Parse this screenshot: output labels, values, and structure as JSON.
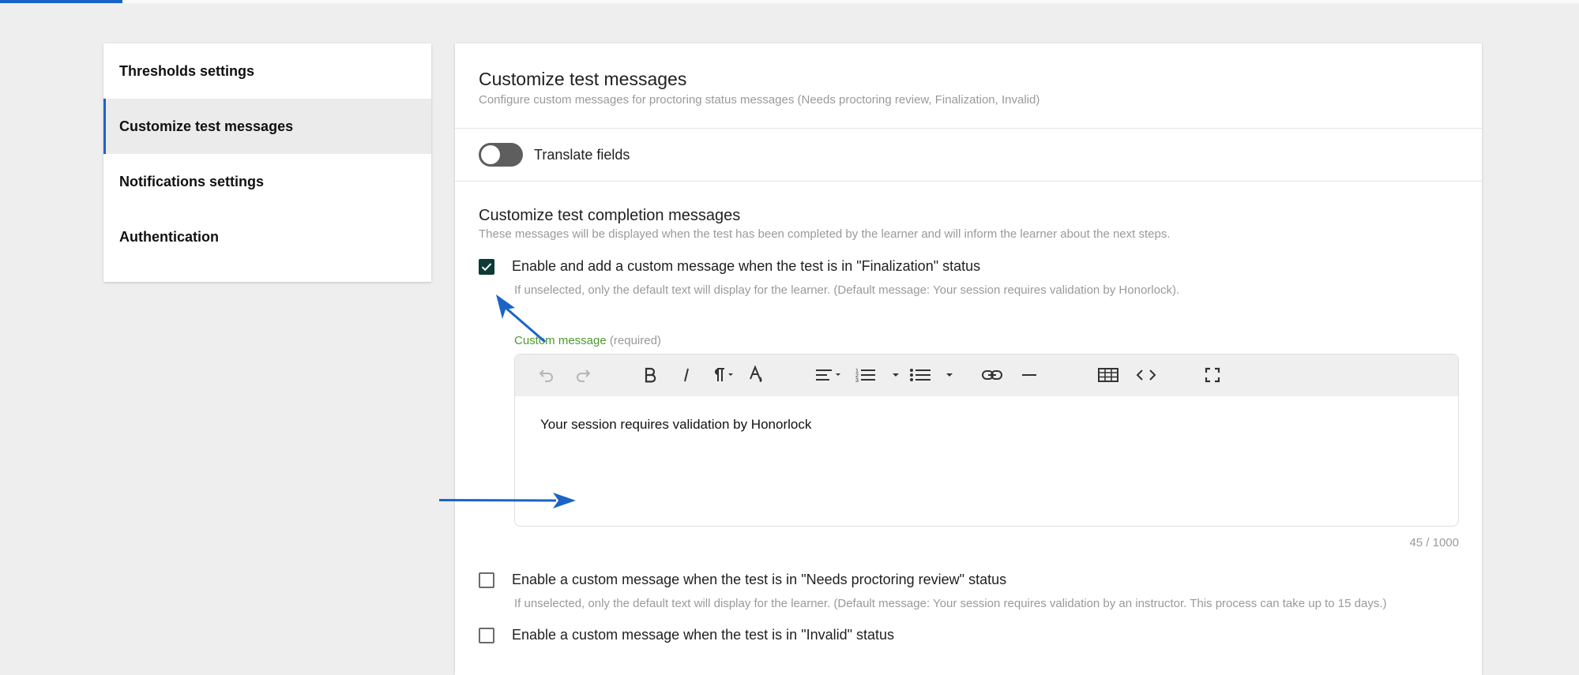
{
  "sidebar": {
    "items": [
      {
        "label": "Thresholds settings",
        "active": false
      },
      {
        "label": "Customize test messages",
        "active": true
      },
      {
        "label": "Notifications settings",
        "active": false
      },
      {
        "label": "Authentication",
        "active": false
      }
    ]
  },
  "panel": {
    "title": "Customize test messages",
    "subtitle": "Configure custom messages for proctoring status messages (Needs proctoring review, Finalization, Invalid)",
    "translate": {
      "label": "Translate fields",
      "enabled": false
    }
  },
  "completion": {
    "title": "Customize test completion messages",
    "subtitle": "These messages will be displayed when the test has been completed by the learner and will inform the learner about the next steps.",
    "finalization": {
      "label": "Enable and add a custom message when the test is in \"Finalization\" status",
      "checked": true,
      "helper": "If unselected, only the default text will display for the learner. (Default message: Your session requires validation by Honorlock).",
      "field_label": "Custom message",
      "field_required": "(required)",
      "editor_text": "Your session requires validation by Honorlock",
      "counter": "45 / 1000"
    },
    "needs_review": {
      "label": "Enable a custom message when the test is in \"Needs proctoring review\" status",
      "checked": false,
      "helper": "If unselected, only the default text will display for the learner. (Default message: Your session requires validation by an instructor. This process can take up to 15 days.)"
    },
    "invalid": {
      "label": "Enable a custom message when the test is in \"Invalid\" status",
      "checked": false
    }
  },
  "toolbar_icons": [
    "undo-icon",
    "redo-icon",
    "bold-icon",
    "italic-icon",
    "paragraph-icon",
    "text-color-icon",
    "align-icon",
    "ordered-list-icon",
    "unordered-list-icon",
    "link-icon",
    "horizontal-rule-icon",
    "table-icon",
    "code-icon",
    "fullscreen-icon"
  ],
  "colors": {
    "accent": "#1b64c6",
    "checkbox": "#0e3a36",
    "required_label": "#4b9a2f"
  }
}
